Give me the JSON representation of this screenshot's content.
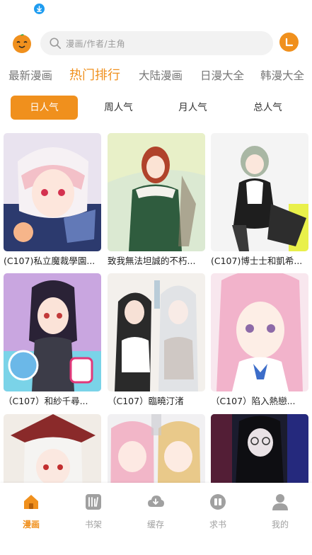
{
  "search": {
    "placeholder": "漫画/作者/主角"
  },
  "colors": {
    "accent": "#f0901d",
    "inactive": "#a0a0a0",
    "search_bg": "#f2f2f2"
  },
  "category_tabs": [
    {
      "label": "最新漫画",
      "active": false
    },
    {
      "label": "热门排行",
      "active": true
    },
    {
      "label": "大陆漫画",
      "active": false
    },
    {
      "label": "日漫大全",
      "active": false
    },
    {
      "label": "韩漫大全",
      "active": false
    }
  ],
  "rank_tabs": [
    {
      "label": "日人气",
      "active": true
    },
    {
      "label": "周人气",
      "active": false
    },
    {
      "label": "月人气",
      "active": false
    },
    {
      "label": "总人气",
      "active": false
    }
  ],
  "comics": [
    {
      "title": "(C107)私立魔裁學園..."
    },
    {
      "title": "致我無法坦誠的不朽..."
    },
    {
      "title": "(C107)博士士和凱希..."
    },
    {
      "title": "（C107）和紗千尋..."
    },
    {
      "title": "（C107）臨曉汀渚"
    },
    {
      "title": "（C107）陷入熱戀..."
    },
    {
      "title": ""
    },
    {
      "title": ""
    },
    {
      "title": ""
    }
  ],
  "bottom_nav": [
    {
      "label": "漫画",
      "icon": "home-icon",
      "active": true
    },
    {
      "label": "书架",
      "icon": "bookshelf-icon",
      "active": false
    },
    {
      "label": "缓存",
      "icon": "cloud-download-icon",
      "active": false
    },
    {
      "label": "求书",
      "icon": "request-book-icon",
      "active": false
    },
    {
      "label": "我的",
      "icon": "user-icon",
      "active": false
    }
  ]
}
